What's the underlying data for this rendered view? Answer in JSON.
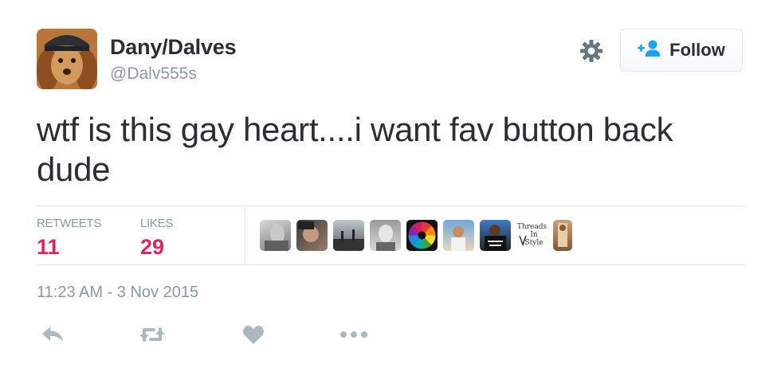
{
  "author": {
    "name": "Dany/Dalves",
    "handle": "@Dalv555s"
  },
  "follow_button": {
    "label": "Follow"
  },
  "tweet_text": "wtf is this gay heart....i want fav button back dude",
  "stats": {
    "retweets_label": "RETWEETS",
    "retweets_value": "11",
    "likes_label": "LIKES",
    "likes_value": "29"
  },
  "liker_avatars": [
    {
      "icon": "liker-avatar-1"
    },
    {
      "icon": "liker-avatar-2"
    },
    {
      "icon": "liker-avatar-3"
    },
    {
      "icon": "liker-avatar-4"
    },
    {
      "icon": "liker-avatar-5"
    },
    {
      "icon": "liker-avatar-6"
    },
    {
      "icon": "liker-avatar-7"
    },
    {
      "icon": "liker-avatar-8",
      "text": [
        "Threads",
        "In",
        "Style"
      ]
    },
    {
      "icon": "liker-avatar-9"
    }
  ],
  "timestamp": "11:23 AM - 3 Nov 2015",
  "actions": [
    "reply-icon",
    "retweet-icon",
    "like-heart-icon",
    "more-icon"
  ],
  "colors": {
    "likes_accent": "#e0245e",
    "muted": "#8899a6",
    "text": "#292f33",
    "follow_icon": "#1da1f2",
    "action_icons": "#aab8c2"
  }
}
